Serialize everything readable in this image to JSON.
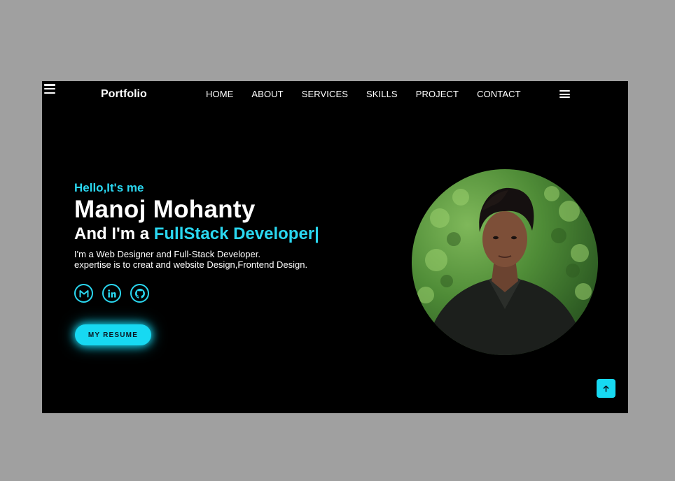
{
  "header": {
    "logo": "Portfolio",
    "nav": [
      "HOME",
      "ABOUT",
      "SERVICES",
      "SKILLS",
      "PROJECT",
      "CONTACT"
    ]
  },
  "hero": {
    "greeting": "Hello,It's me",
    "name": "Manoj Mohanty",
    "role_prefix": "And I'm a ",
    "role_highlight": "FullStack Developer|",
    "desc_line1": "I'm a Web Designer and Full-Stack Developer.",
    "desc_line2": "expertise is to creat and website Design,Frontend Design.",
    "resume_label": "MY RESUME"
  },
  "socials": [
    "gmail-icon",
    "linkedin-icon",
    "github-icon"
  ],
  "icons": {
    "top_menu": "hamburger-menu-icon",
    "nav_menu": "hamburger-menu-icon",
    "scroll_top": "arrow-up-icon"
  },
  "colors": {
    "accent": "#17d9f2",
    "background": "#000000",
    "page": "#a0a0a0"
  }
}
